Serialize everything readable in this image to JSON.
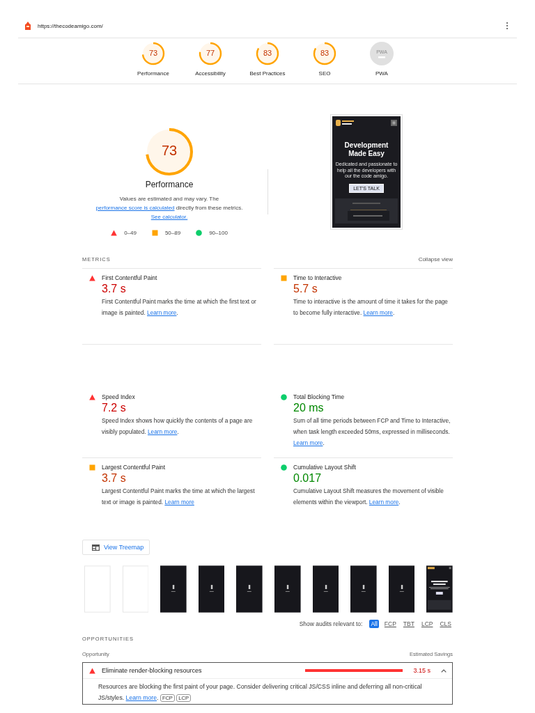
{
  "header": {
    "url": "https://thecodeamigo.com/"
  },
  "gauges": [
    {
      "kind": "score",
      "score": "73",
      "label": "Performance",
      "color": "#ffa400"
    },
    {
      "kind": "score",
      "score": "77",
      "label": "Accessibility",
      "color": "#ffa400"
    },
    {
      "kind": "score",
      "score": "83",
      "label": "Best Practices",
      "color": "#ffa400"
    },
    {
      "kind": "score",
      "score": "83",
      "label": "SEO",
      "color": "#ffa400"
    },
    {
      "kind": "pwa",
      "badge": "PWA",
      "label": "PWA"
    }
  ],
  "performance": {
    "score": "73",
    "color": "#ffa400",
    "title": "Performance",
    "note": [
      {
        "text": "Values are estimated and may vary. The "
      },
      {
        "text": "performance score is calculated",
        "link": true
      },
      {
        "text": " directly from these metrics. "
      },
      {
        "text": "See calculator.",
        "link": true
      }
    ],
    "legend": [
      {
        "kind": "fail",
        "range": "0–49"
      },
      {
        "kind": "average",
        "range": "50–89"
      },
      {
        "kind": "pass",
        "range": "90–100"
      }
    ]
  },
  "screenshot": {
    "heading": "Development Made Easy",
    "description": "Dedicated and passionate to help all the developers with our the code amigo.",
    "button": "LET'S TALK"
  },
  "metrics": {
    "title": "METRICS",
    "toggle": "Collapse view",
    "items": [
      {
        "kind": "fail",
        "name": "First Contentful Paint",
        "value": "3.7 s",
        "description": "First Contentful Paint marks the time at which the first text or image is painted. ",
        "link": "Learn more",
        "after": "."
      },
      {
        "kind": "average",
        "name": "Time to Interactive",
        "value": "5.7 s",
        "description": "Time to interactive is the amount of time it takes for the page to become fully interactive. ",
        "link": "Learn more",
        "after": "."
      },
      {
        "kind": "fail",
        "name": "Speed Index",
        "value": "7.2 s",
        "description": "Speed Index shows how quickly the contents of a page are visibly populated. ",
        "link": "Learn more",
        "after": "."
      },
      {
        "kind": "pass",
        "name": "Total Blocking Time",
        "value": "20 ms",
        "description": "Sum of all time periods between FCP and Time to Interactive, when task length exceeded 50ms, expressed in milliseconds. ",
        "link": "Learn more",
        "after": "."
      },
      {
        "kind": "average",
        "name": "Largest Contentful Paint",
        "value": "3.7 s",
        "description": "Largest Contentful Paint marks the time at which the largest text or image is painted. ",
        "link": "Learn more"
      },
      {
        "kind": "pass",
        "name": "Cumulative Layout Shift",
        "value": "0.017",
        "description": "Cumulative Layout Shift measures the movement of visible elements within the viewport. ",
        "link": "Learn more",
        "after": "."
      }
    ]
  },
  "treemap_button": "View Treemap",
  "filmstrip": [
    {
      "kind": "blank"
    },
    {
      "kind": "blank"
    },
    {
      "kind": "loading"
    },
    {
      "kind": "loading"
    },
    {
      "kind": "loading"
    },
    {
      "kind": "loading"
    },
    {
      "kind": "loading"
    },
    {
      "kind": "loading"
    },
    {
      "kind": "loading"
    },
    {
      "kind": "page"
    }
  ],
  "filter": {
    "label": "Show audits relevant to:",
    "options": [
      {
        "label": "All",
        "selected": true
      },
      {
        "label": "FCP",
        "selected": false
      },
      {
        "label": "TBT",
        "selected": false
      },
      {
        "label": "LCP",
        "selected": false
      },
      {
        "label": "CLS",
        "selected": false
      }
    ]
  },
  "opportunities": {
    "title": "OPPORTUNITIES",
    "column_1": "Opportunity",
    "column_2": "Estimated Savings",
    "items": [
      {
        "kind": "fail",
        "title": "Eliminate render-blocking resources",
        "savings": "3.15 s",
        "expanded": true,
        "description": "Resources are blocking the first paint of your page. Consider delivering critical JS/CSS inline and deferring all non-critical JS/styles. ",
        "link": "Learn more",
        "after": ".",
        "tags": [
          "FCP",
          "LCP"
        ]
      }
    ]
  }
}
